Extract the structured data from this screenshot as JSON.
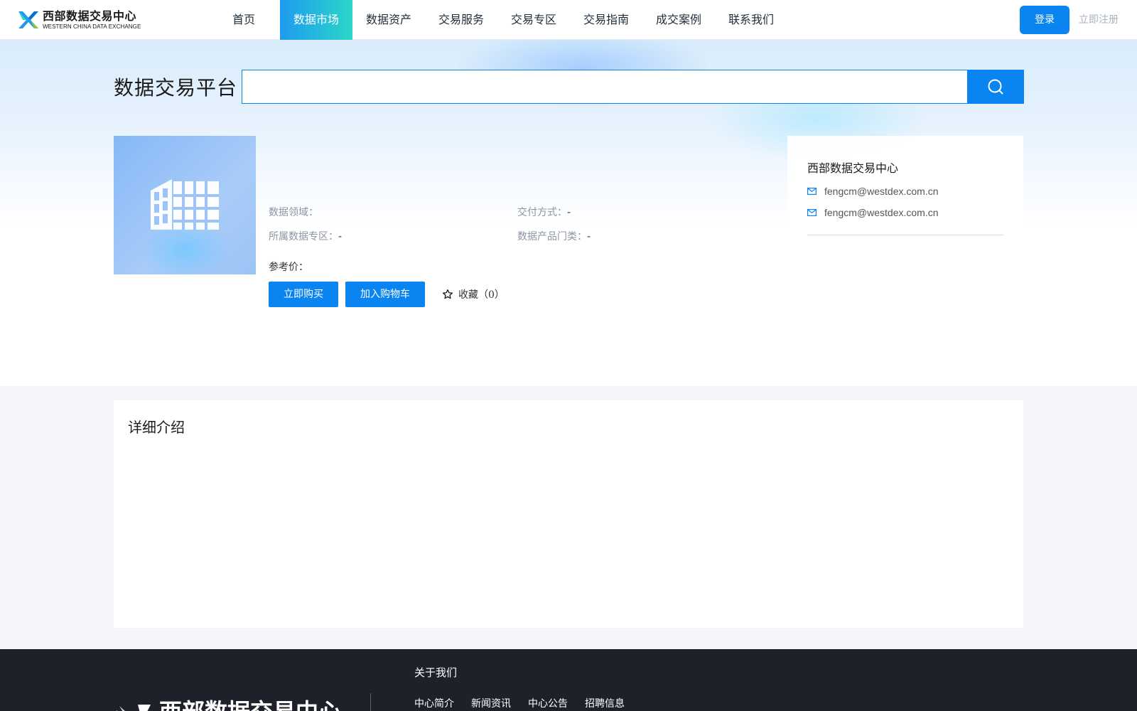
{
  "header": {
    "logo_cn": "西部数据交易中心",
    "logo_en": "WESTERN CHINA DATA EXCHANGE",
    "nav": [
      "首页",
      "数据市场",
      "数据资产",
      "交易服务",
      "交易专区",
      "交易指南",
      "成交案例",
      "联系我们"
    ],
    "active_nav": "数据市场",
    "login_label": "登录",
    "register_label": "立即注册"
  },
  "search": {
    "platform_title": "数据交易平台",
    "value": "",
    "placeholder": ""
  },
  "product": {
    "domain_label": "数据领域：",
    "domain_value": "",
    "delivery_label": "交付方式：",
    "delivery_value": "-",
    "zone_label": "所属数据专区：",
    "zone_value": "-",
    "category_label": "数据产品门类：",
    "category_value": "-",
    "price_label": "参考价：",
    "buy_label": "立即购买",
    "cart_label": "加入购物车",
    "fav_label": "收藏",
    "fav_count": "（0）"
  },
  "org": {
    "name": "西部数据交易中心",
    "emails": [
      "fengcm@westdex.com.cn",
      "fengcm@westdex.com.cn"
    ]
  },
  "detail": {
    "title": "详细介绍"
  },
  "footer": {
    "logo_text": "西部数据交易中心",
    "about_label": "关于我们",
    "links": [
      "中心简介",
      "新闻资讯",
      "中心公告",
      "招聘信息"
    ]
  },
  "colors": {
    "primary": "#0a84f0",
    "nav_active_start": "#1e9bf0",
    "nav_active_end": "#2cd6c8",
    "footer_bg": "#1e2129"
  },
  "icons": [
    "logo-mark-icon",
    "search-icon",
    "building-icon",
    "star-outline-icon",
    "mail-icon"
  ]
}
